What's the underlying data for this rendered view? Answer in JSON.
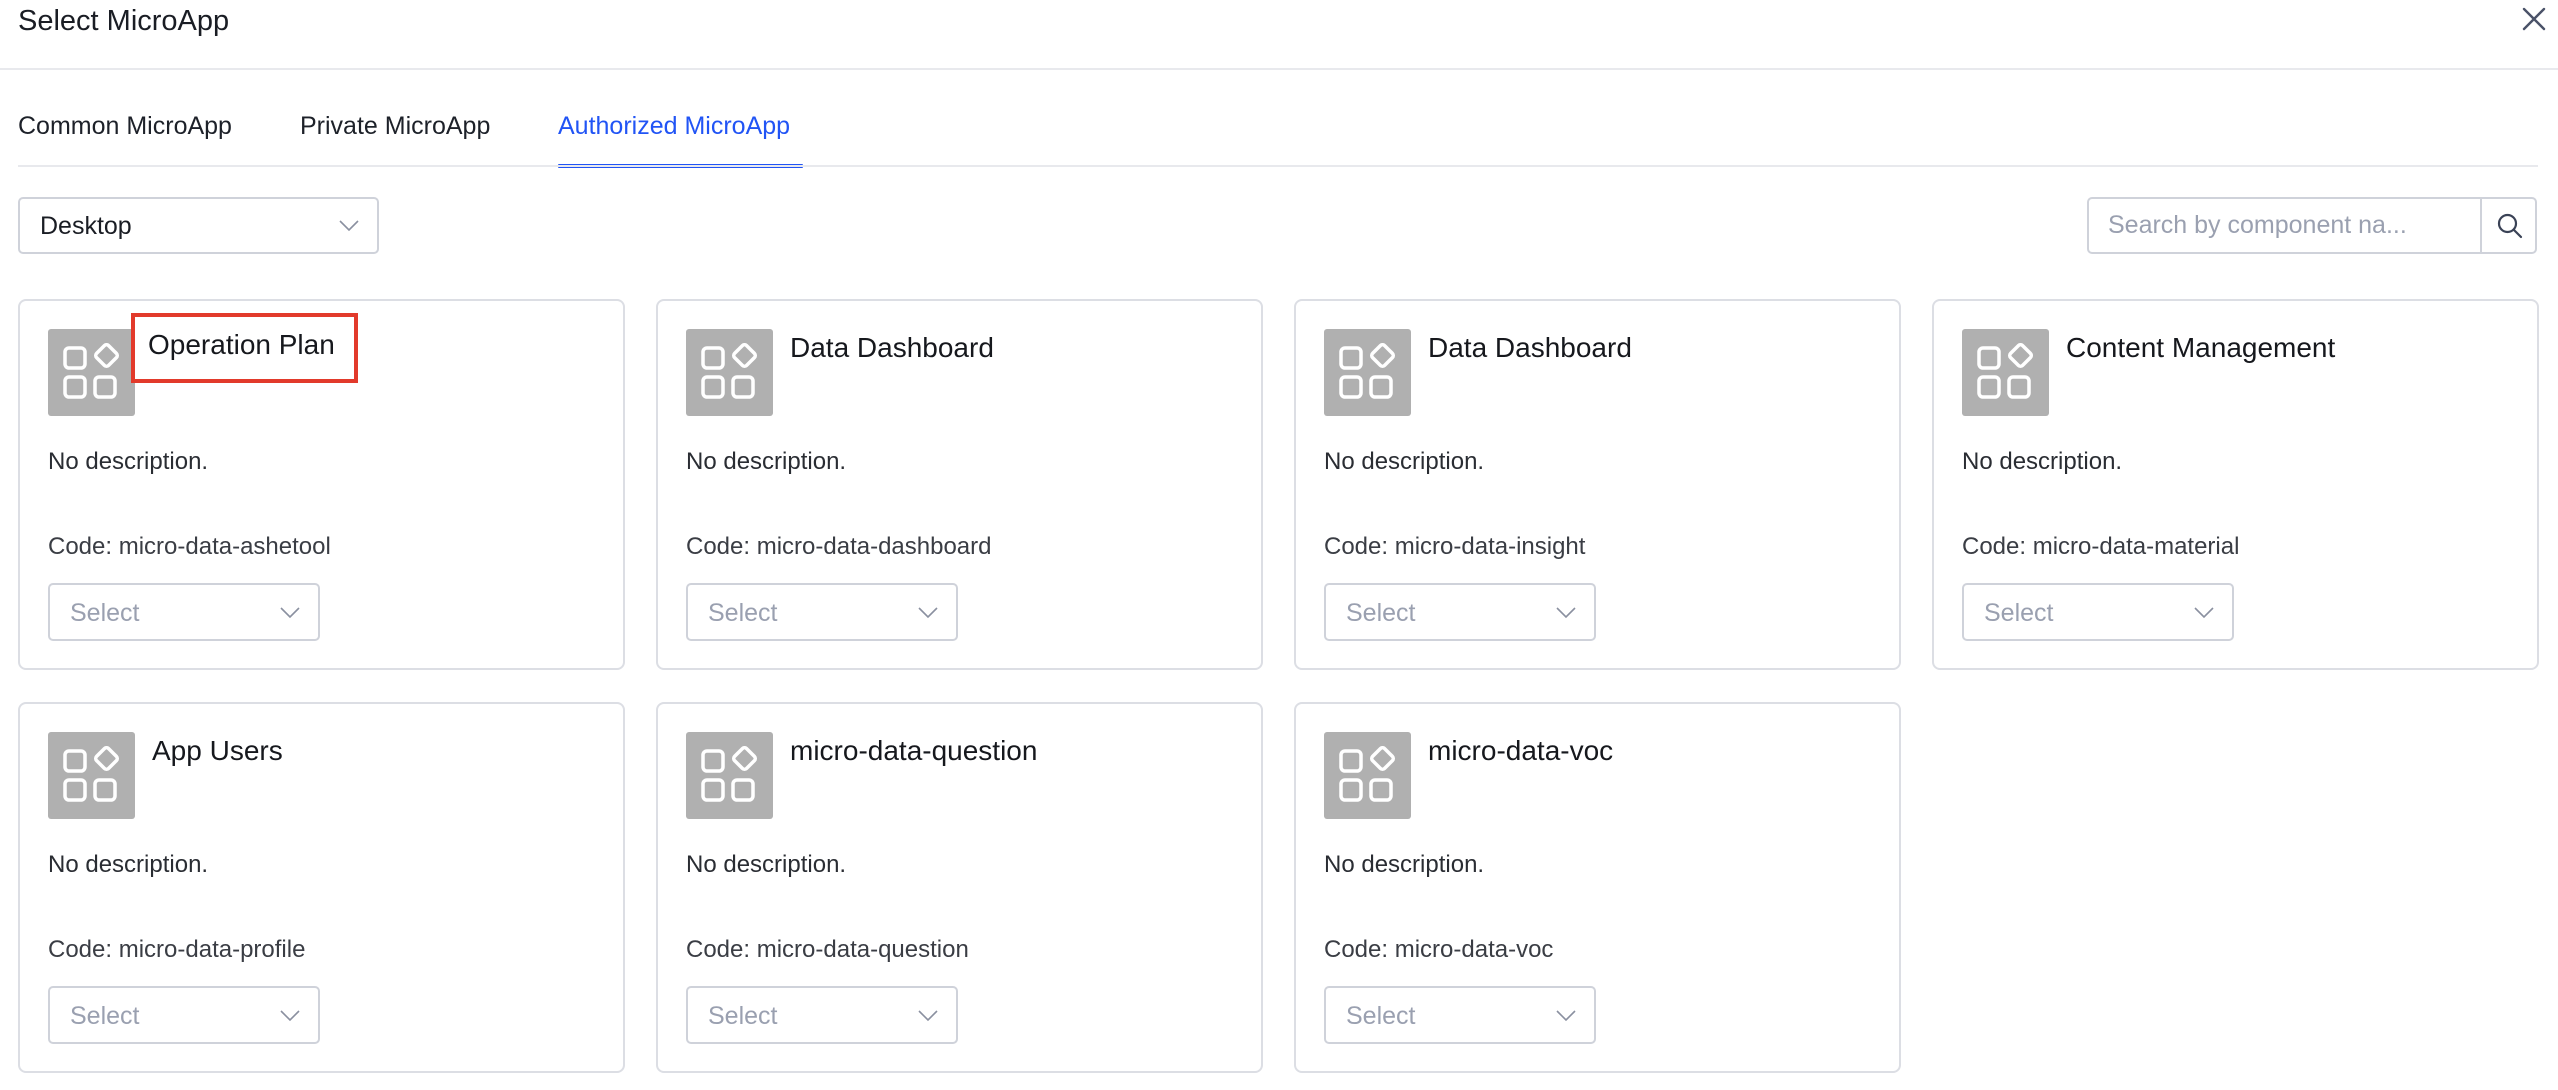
{
  "dialog": {
    "title": "Select MicroApp",
    "close_icon": "close-icon"
  },
  "tabs": [
    {
      "label": "Common MicroApp",
      "active": false
    },
    {
      "label": "Private MicroApp",
      "active": false
    },
    {
      "label": "Authorized MicroApp",
      "active": true
    }
  ],
  "colors": {
    "accent": "#2154f5",
    "highlight_border": "#e23a2b",
    "icon_bg": "#b0b0b0",
    "placeholder": "#9aa0b0"
  },
  "filters": {
    "platform": {
      "value": "Desktop",
      "icon": "chevron-down-icon"
    },
    "search": {
      "placeholder": "Search by component na...",
      "value": "",
      "icon": "search-icon"
    }
  },
  "apps": [
    {
      "title": "Operation Plan",
      "description": "No description.",
      "code": "Code: micro-data-ashetool",
      "select_placeholder": "Select",
      "highlighted": true
    },
    {
      "title": "Data Dashboard",
      "description": "No description.",
      "code": "Code: micro-data-dashboard",
      "select_placeholder": "Select",
      "highlighted": false
    },
    {
      "title": "Data Dashboard",
      "description": "No description.",
      "code": "Code: micro-data-insight",
      "select_placeholder": "Select",
      "highlighted": false
    },
    {
      "title": "Content Management",
      "description": "No description.",
      "code": "Code: micro-data-material",
      "select_placeholder": "Select",
      "highlighted": false
    },
    {
      "title": "App Users",
      "description": "No description.",
      "code": "Code: micro-data-profile",
      "select_placeholder": "Select",
      "highlighted": false
    },
    {
      "title": "micro-data-question",
      "description": "No description.",
      "code": "Code: micro-data-question",
      "select_placeholder": "Select",
      "highlighted": false
    },
    {
      "title": "micro-data-voc",
      "description": "No description.",
      "code": "Code: micro-data-voc",
      "select_placeholder": "Select",
      "highlighted": false
    }
  ]
}
